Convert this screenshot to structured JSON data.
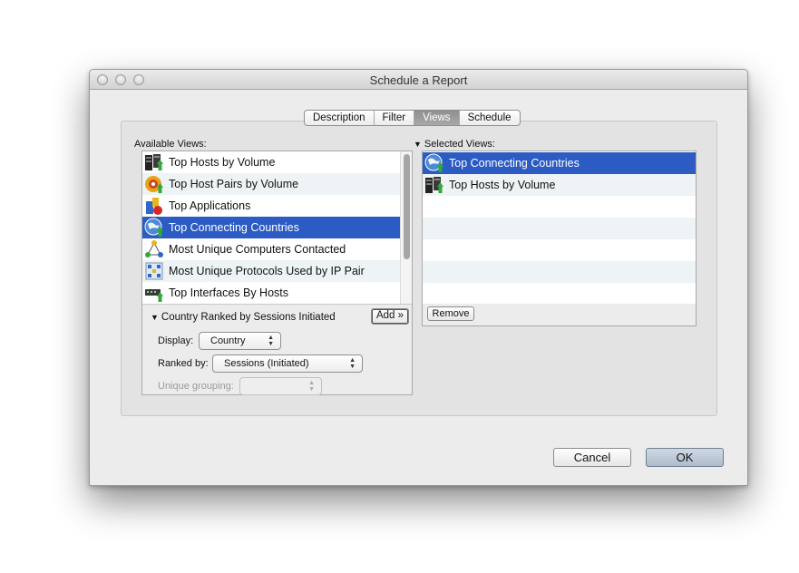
{
  "window": {
    "title": "Schedule a Report"
  },
  "tabs": [
    {
      "label": "Description",
      "selected": false
    },
    {
      "label": "Filter",
      "selected": false
    },
    {
      "label": "Views",
      "selected": true
    },
    {
      "label": "Schedule",
      "selected": false
    }
  ],
  "available": {
    "label": "Available Views:",
    "items": [
      {
        "label": "Top Hosts by Volume",
        "icon": "hosts-volume-icon"
      },
      {
        "label": "Top Host Pairs by Volume",
        "icon": "host-pairs-icon"
      },
      {
        "label": "Top Applications",
        "icon": "applications-icon"
      },
      {
        "label": "Top Connecting Countries",
        "icon": "globe-icon",
        "selected": true
      },
      {
        "label": "Most Unique Computers Contacted",
        "icon": "network-icon"
      },
      {
        "label": "Most Unique Protocols Used by IP Pair",
        "icon": "protocols-icon"
      },
      {
        "label": "Top Interfaces By Hosts",
        "icon": "interface-icon"
      }
    ]
  },
  "details": {
    "title": "Country Ranked by Sessions Initiated",
    "add_label": "Add »",
    "display_label": "Display:",
    "display_value": "Country",
    "ranked_label": "Ranked by:",
    "ranked_value": "Sessions (Initiated)",
    "grouping_label": "Unique grouping:",
    "grouping_value": ""
  },
  "selected": {
    "label": "Selected Views:",
    "items": [
      {
        "label": "Top Connecting Countries",
        "icon": "globe-icon",
        "selected": true
      },
      {
        "label": "Top Hosts by Volume",
        "icon": "hosts-volume-icon"
      }
    ],
    "remove_label": "Remove"
  },
  "buttons": {
    "cancel": "Cancel",
    "ok": "OK"
  },
  "colors": {
    "selection": "#2b5bc3",
    "alt_row": "#eef4f6",
    "ok_button": "#b9c6d4"
  }
}
